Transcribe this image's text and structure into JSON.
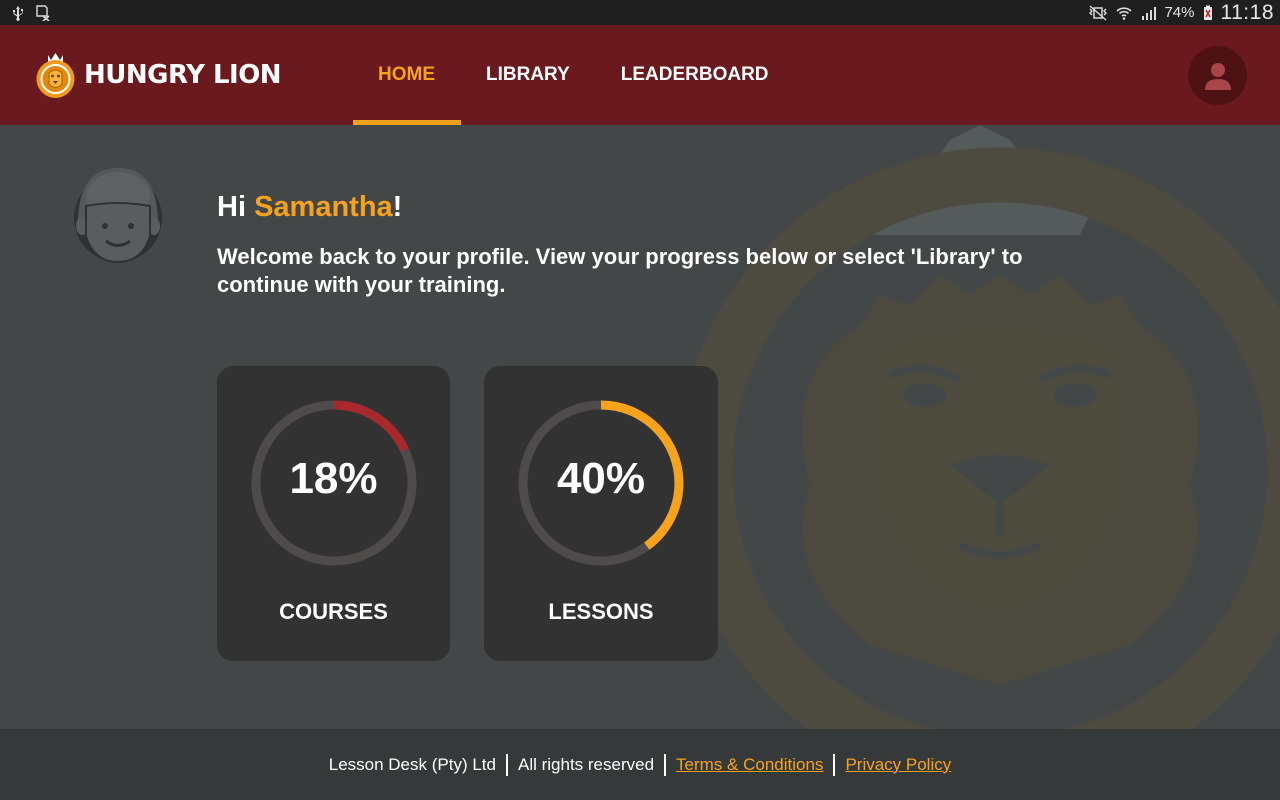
{
  "status_bar": {
    "battery": "74%",
    "time": "11:18"
  },
  "header": {
    "brand": "HUNGRY LION",
    "nav": [
      {
        "label": "HOME",
        "active": true
      },
      {
        "label": "LIBRARY",
        "active": false
      },
      {
        "label": "LEADERBOARD",
        "active": false
      }
    ]
  },
  "main": {
    "greeting_prefix": "Hi ",
    "user_name": "Samantha",
    "greeting_suffix": "!",
    "welcome_text": "Welcome back to your profile. View your progress below or select 'Library' to continue with your training.",
    "progress": [
      {
        "label": "COURSES",
        "value_text": "18%",
        "value": 0.18,
        "color": "#a8292d"
      },
      {
        "label": "LESSONS",
        "value_text": "40%",
        "value": 0.4,
        "color": "#f7a21d"
      }
    ]
  },
  "footer": {
    "company": "Lesson Desk (Pty) Ltd",
    "rights": "All rights reserved",
    "terms_link": "Terms & Conditions",
    "privacy_link": "Privacy Policy"
  },
  "colors": {
    "header_bg": "#6a1a1e",
    "accent": "#f7a21d",
    "card_bg": "#323233",
    "ring_track": "#4f4b4b"
  }
}
